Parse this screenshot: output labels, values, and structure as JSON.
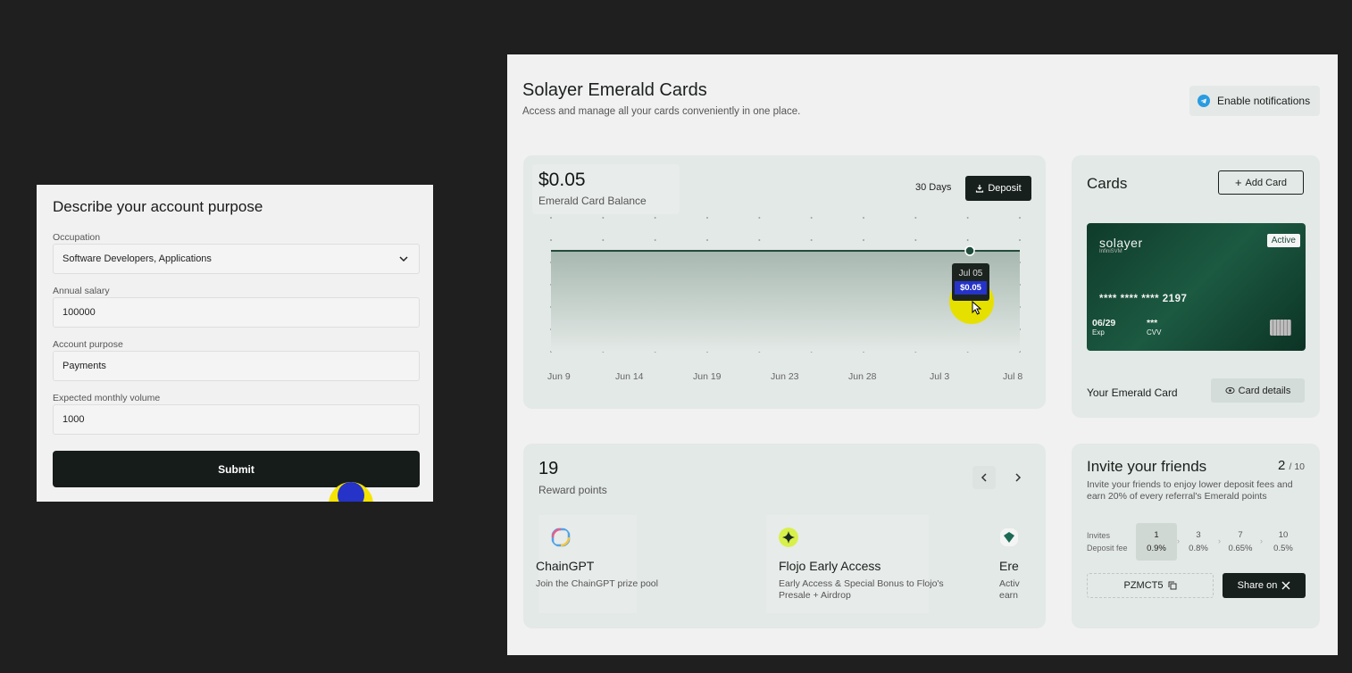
{
  "form": {
    "title": "Describe your account purpose",
    "fields": [
      {
        "label": "Occupation",
        "value": "Software Developers, Applications"
      },
      {
        "label": "Annual salary",
        "value": "100000"
      },
      {
        "label": "Account purpose",
        "value": "Payments"
      },
      {
        "label": "Expected monthly volume",
        "value": "1000"
      }
    ],
    "submit_label": "Submit"
  },
  "header": {
    "title": "Solayer Emerald Cards",
    "subtitle": "Access and manage all your cards conveniently in one place.",
    "notifications_label": "Enable notifications"
  },
  "balance": {
    "amount": "$0.05",
    "label": "Emerald Card Balance",
    "range_label": "30 Days",
    "deposit_label": "Deposit",
    "tooltip": {
      "date": "Jul 05",
      "value": "$0.05"
    }
  },
  "chart_data": {
    "type": "area",
    "x_ticks": [
      "Jun 9",
      "Jun 14",
      "Jun 19",
      "Jun 23",
      "Jun 28",
      "Jul 3",
      "Jul 8"
    ],
    "series": [
      {
        "x": [
          "Jun 9",
          "Jul 8"
        ],
        "values": [
          0.05,
          0.05
        ]
      }
    ],
    "highlight": {
      "x": "Jul 05",
      "y": 0.05
    },
    "grid": true
  },
  "cards": {
    "title": "Cards",
    "add_label": "Add Card",
    "card": {
      "brand": "solayer",
      "brand_sub": "InfiniSVM",
      "status": "Active",
      "number": "**** **** **** 2197",
      "exp_value": "06/29",
      "exp_label": "Exp",
      "cvv_value": "***",
      "cvv_label": "CVV"
    },
    "name_label": "Your Emerald Card",
    "details_label": "Card details"
  },
  "rewards": {
    "points": "19",
    "label": "Reward points",
    "items": [
      {
        "title": "ChainGPT",
        "desc": "Join the ChainGPT prize pool"
      },
      {
        "title": "Flojo Early Access",
        "desc": "Early Access & Special Bonus to Flojo's Presale + Airdrop"
      },
      {
        "title": "Ere",
        "desc": "Activ earn"
      }
    ]
  },
  "invite": {
    "title": "Invite your friends",
    "count": "2",
    "total": "/ 10",
    "desc": "Invite your friends to enjoy lower deposit fees and earn 20% of every referral's Emerald points",
    "invites_label": "Invites",
    "fee_label": "Deposit fee",
    "tiers": [
      {
        "invites": "1",
        "fee": "0.9%"
      },
      {
        "invites": "3",
        "fee": "0.8%"
      },
      {
        "invites": "7",
        "fee": "0.65%"
      },
      {
        "invites": "10",
        "fee": "0.5%"
      }
    ],
    "code": "PZMCT5",
    "share_label": "Share on"
  },
  "colors": {
    "accent": "#17201c",
    "panel": "#e3e9e6",
    "card_green": "#1c5a42",
    "highlight_blue": "#2533c8"
  }
}
